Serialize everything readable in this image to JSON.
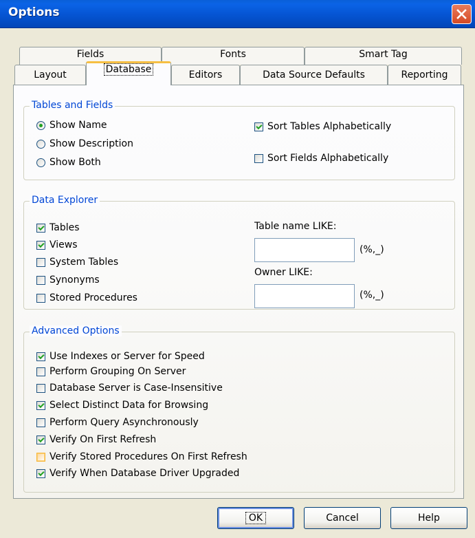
{
  "window": {
    "title": "Options"
  },
  "tabs": {
    "row1": [
      "Fields",
      "Fonts",
      "Smart Tag"
    ],
    "row2": [
      "Layout",
      "Database",
      "Editors",
      "Data Source Defaults",
      "Reporting"
    ]
  },
  "tables_fields": {
    "title": "Tables and Fields",
    "show_name": "Show Name",
    "show_description": "Show Description",
    "show_both": "Show Both",
    "sort_tables": "Sort Tables Alphabetically",
    "sort_fields": "Sort Fields Alphabetically"
  },
  "data_explorer": {
    "title": "Data Explorer",
    "tables": "Tables",
    "views": "Views",
    "system_tables": "System Tables",
    "synonyms": "Synonyms",
    "stored_procedures": "Stored Procedures",
    "table_like_label": "Table name LIKE:",
    "table_like_value": "",
    "table_hint": "(%,_)",
    "owner_like_label": "Owner LIKE:",
    "owner_like_value": "",
    "owner_hint": "(%,_)"
  },
  "advanced": {
    "title": "Advanced Options",
    "items": [
      "Use Indexes or Server for Speed",
      "Perform Grouping On Server",
      "Database Server is Case-Insensitive",
      "Select Distinct Data for Browsing",
      "Perform Query Asynchronously",
      "Verify On First Refresh",
      "Verify Stored Procedures On First Refresh",
      "Verify When Database Driver Upgraded"
    ]
  },
  "buttons": {
    "ok": "OK",
    "cancel": "Cancel",
    "help": "Help"
  }
}
